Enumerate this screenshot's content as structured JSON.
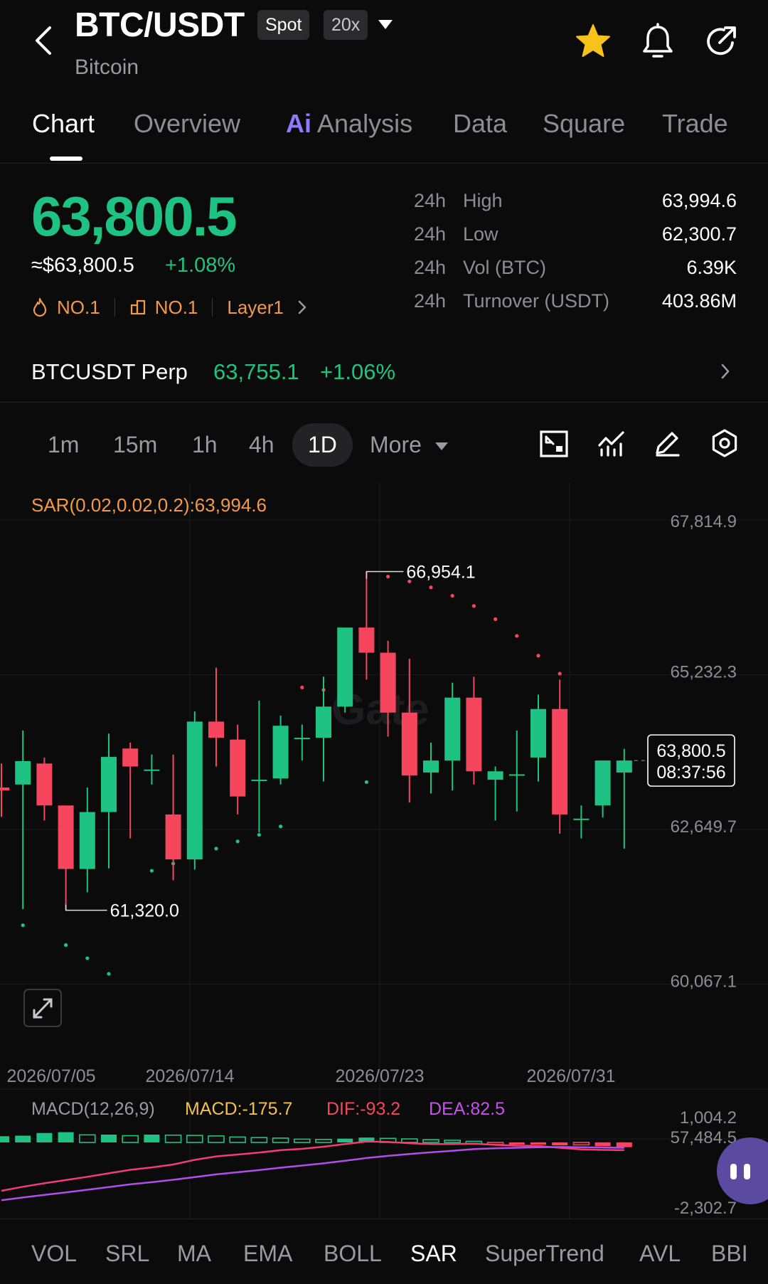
{
  "header": {
    "pair": "BTC/USDT",
    "market_badge": "Spot",
    "leverage_badge": "20x",
    "coin_name": "Bitcoin",
    "icons": [
      "back-arrow-icon",
      "dropdown-caret-icon",
      "star-icon",
      "bell-icon",
      "share-icon"
    ],
    "accent": "#f7c21a"
  },
  "tabs": [
    {
      "label": "Chart"
    },
    {
      "ai": "Ai",
      "label": "Analysis"
    },
    {
      "label": "Overview"
    },
    {
      "label": "Data"
    },
    {
      "label": "Square"
    },
    {
      "label": "Trade"
    }
  ],
  "price": {
    "last": "63,800.5",
    "usd": "≈$63,800.5",
    "change": "+1.08%",
    "tag1": "NO.1",
    "tag2": "NO.1",
    "tag3": "Layer1",
    "color_up": "#1ec383",
    "color_down": "#f6465d"
  },
  "stats": [
    {
      "period": "24h",
      "label": "High",
      "value": "63,994.6"
    },
    {
      "period": "24h",
      "label": "Low",
      "value": "62,300.7"
    },
    {
      "period": "24h",
      "label": "Vol (BTC)",
      "value": "6.39K"
    },
    {
      "period": "24h",
      "label": "Turnover (USDT)",
      "value": "403.86M"
    }
  ],
  "perp": {
    "name": "BTCUSDT Perp",
    "price": "63,755.1",
    "change": "+1.06%"
  },
  "timeframes": {
    "items": [
      "1m",
      "15m",
      "1h",
      "4h",
      "1D"
    ],
    "active": "1D",
    "more": "More"
  },
  "chart_data": [
    {
      "type": "candlestick",
      "title": "",
      "indicator_label": "SAR(0.02,0.02,0.2):63,994.6",
      "y_ticks": [
        "67,814.9",
        "65,232.3",
        "62,649.7",
        "60,067.1",
        "57,484.5"
      ],
      "x_ticks": [
        "2026/07/05",
        "2026/07/14",
        "2026/07/23",
        "2026/07/31"
      ],
      "ylim": [
        57484.5,
        67814.9
      ],
      "high_label": "66,954.1",
      "low_label": "61,320.0",
      "current_price": "63,800.5",
      "countdown": "08:37:56",
      "watermark": "Gate",
      "candles": [
        [
          63350,
          63300,
          63750,
          62860
        ],
        [
          63400,
          63790,
          64300,
          61320
        ],
        [
          63750,
          63050,
          63850,
          62800
        ],
        [
          63050,
          61990,
          63050,
          61300
        ],
        [
          61990,
          62940,
          63350,
          61600
        ],
        [
          62940,
          63860,
          64250,
          62000
        ],
        [
          64000,
          63700,
          64100,
          62500
        ],
        [
          63650,
          63650,
          63900,
          63400
        ],
        [
          62900,
          62150,
          63900,
          61800
        ],
        [
          62150,
          64450,
          64620,
          61980
        ],
        [
          64450,
          64180,
          65350,
          63700
        ],
        [
          64150,
          63200,
          64400,
          62900
        ],
        [
          63480,
          63480,
          64800,
          62600
        ],
        [
          63500,
          64380,
          64550,
          63400
        ],
        [
          64180,
          64180,
          64400,
          63800
        ],
        [
          64180,
          64700,
          65200,
          63450
        ],
        [
          64700,
          66020,
          66000,
          64600
        ],
        [
          66020,
          65600,
          66954.1,
          65150
        ],
        [
          65600,
          64600,
          65800,
          64200
        ],
        [
          64600,
          63550,
          65500,
          63100
        ],
        [
          63600,
          63800,
          64100,
          63250
        ],
        [
          63800,
          64850,
          65100,
          63300
        ],
        [
          64850,
          63620,
          65200,
          63400
        ],
        [
          63480,
          63620,
          63700,
          62800
        ],
        [
          63570,
          63570,
          64300,
          62950
        ],
        [
          63850,
          64660,
          64900,
          63450
        ],
        [
          64660,
          62900,
          65150,
          62580
        ],
        [
          62820,
          62830,
          63050,
          62500
        ],
        [
          63050,
          63800,
          63650,
          62850
        ],
        [
          63600,
          63800,
          63994.6,
          62330
        ]
      ],
      "sar": [
        [
          1,
          61050
        ],
        [
          3,
          60720
        ],
        [
          4,
          60500
        ],
        [
          5,
          60240
        ],
        [
          7,
          61960
        ],
        [
          8,
          62080
        ],
        [
          9,
          62210
        ],
        [
          10,
          62330
        ],
        [
          11,
          62450
        ],
        [
          12,
          62560
        ],
        [
          13,
          62700
        ],
        [
          14,
          65020
        ],
        [
          15,
          64980
        ],
        [
          16,
          64930
        ],
        [
          17,
          63440
        ],
        [
          18,
          66870
        ],
        [
          19,
          66790
        ],
        [
          20,
          66690
        ],
        [
          21,
          66550
        ],
        [
          22,
          66380
        ],
        [
          23,
          66160
        ],
        [
          24,
          65880
        ],
        [
          25,
          65550
        ],
        [
          26,
          65250
        ]
      ],
      "sar_color": "#f6465d",
      "sar_color_up": "#1ec383"
    },
    {
      "type": "macd",
      "params": "MACD(12,26,9)",
      "macd_label": "MACD:-175.7",
      "dif_label": "DIF:-93.2",
      "dea_label": "DEA:82.5",
      "y_ticks": [
        "1,004.2",
        "-2,302.7"
      ],
      "ylim": [
        -2302.7,
        1004.2
      ],
      "hist": [
        230,
        250,
        350,
        380,
        280,
        290,
        250,
        290,
        270,
        260,
        240,
        200,
        180,
        160,
        120,
        110,
        140,
        180,
        150,
        130,
        100,
        80,
        40,
        -10,
        -40,
        -60,
        -110,
        -90,
        -140,
        -175.7
      ],
      "dif": [
        -1800,
        -1650,
        -1520,
        -1400,
        -1280,
        -1150,
        -1020,
        -930,
        -820,
        -650,
        -520,
        -450,
        -380,
        -290,
        -240,
        -160,
        -60,
        30,
        20,
        -30,
        -60,
        -60,
        -50,
        -90,
        -120,
        -130,
        -200,
        -260,
        -280,
        -290
      ],
      "dea": [
        -2150,
        -2050,
        -1950,
        -1860,
        -1760,
        -1660,
        -1560,
        -1480,
        -1390,
        -1290,
        -1190,
        -1110,
        -1030,
        -940,
        -860,
        -780,
        -680,
        -580,
        -500,
        -430,
        -370,
        -310,
        -250,
        -220,
        -200,
        -180,
        -170,
        -180,
        -190,
        -200
      ]
    }
  ],
  "indicators": {
    "items": [
      "VOL",
      "SRL",
      "MA",
      "EMA",
      "BOLL",
      "SAR",
      "SuperTrend",
      "AVL",
      "BBI"
    ],
    "active": "SAR"
  }
}
